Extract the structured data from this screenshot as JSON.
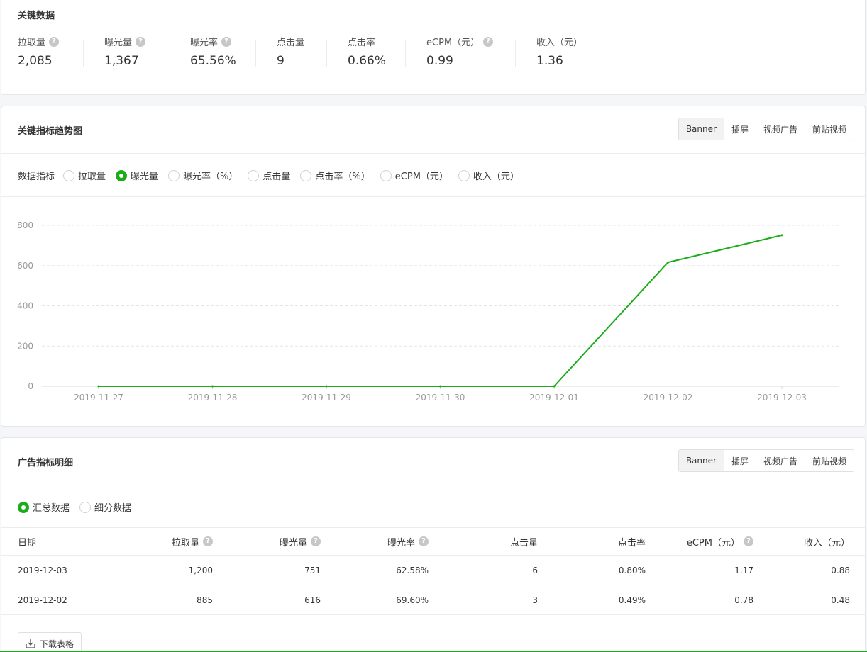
{
  "kpi": {
    "title": "关键数据",
    "items": [
      {
        "label": "拉取量",
        "value": "2,085",
        "help": true
      },
      {
        "label": "曝光量",
        "value": "1,367",
        "help": true
      },
      {
        "label": "曝光率",
        "value": "65.56%",
        "help": true
      },
      {
        "label": "点击量",
        "value": "9",
        "help": false
      },
      {
        "label": "点击率",
        "value": "0.66%",
        "help": false
      },
      {
        "label": "eCPM（元）",
        "value": "0.99",
        "help": true
      },
      {
        "label": "收入（元）",
        "value": "1.36",
        "help": false
      }
    ]
  },
  "trend": {
    "title": "关键指标趋势图",
    "tabs": [
      "Banner",
      "插屏",
      "视频广告",
      "前贴视频"
    ],
    "active_tab": "Banner",
    "metric_label": "数据指标",
    "metrics": [
      "拉取量",
      "曝光量",
      "曝光率（%）",
      "点击量",
      "点击率（%）",
      "eCPM（元）",
      "收入（元）"
    ],
    "selected_metric": "曝光量"
  },
  "chart_data": {
    "type": "line",
    "title": "",
    "xlabel": "",
    "ylabel": "",
    "x": [
      "2019-11-27",
      "2019-11-28",
      "2019-11-29",
      "2019-11-30",
      "2019-12-01",
      "2019-12-02",
      "2019-12-03"
    ],
    "series": [
      {
        "values": [
          0,
          0,
          0,
          0,
          0,
          616,
          751
        ],
        "color": "#1aad19"
      }
    ],
    "yticks": [
      0,
      200,
      400,
      600,
      800
    ],
    "ylim": [
      0,
      800
    ],
    "grid": true,
    "legend": "none"
  },
  "detail": {
    "title": "广告指标明细",
    "tabs": [
      "Banner",
      "插屏",
      "视频广告",
      "前贴视频"
    ],
    "active_tab": "Banner",
    "views": [
      "汇总数据",
      "细分数据"
    ],
    "selected_view": "汇总数据",
    "columns": [
      {
        "label": "日期",
        "help": false
      },
      {
        "label": "拉取量",
        "help": true
      },
      {
        "label": "曝光量",
        "help": true
      },
      {
        "label": "曝光率",
        "help": true
      },
      {
        "label": "点击量",
        "help": false
      },
      {
        "label": "点击率",
        "help": false
      },
      {
        "label": "eCPM（元）",
        "help": true
      },
      {
        "label": "收入（元）",
        "help": false
      }
    ],
    "rows": [
      [
        "2019-12-03",
        "1,200",
        "751",
        "62.58%",
        "6",
        "0.80%",
        "1.17",
        "0.88"
      ],
      [
        "2019-12-02",
        "885",
        "616",
        "69.60%",
        "3",
        "0.49%",
        "0.78",
        "0.48"
      ]
    ],
    "download_label": "下载表格"
  },
  "colors": {
    "accent": "#1aad19",
    "border": "#e7e7eb",
    "muted": "#999999"
  },
  "icons": {
    "help": "question-circle-icon",
    "download": "download-icon"
  }
}
